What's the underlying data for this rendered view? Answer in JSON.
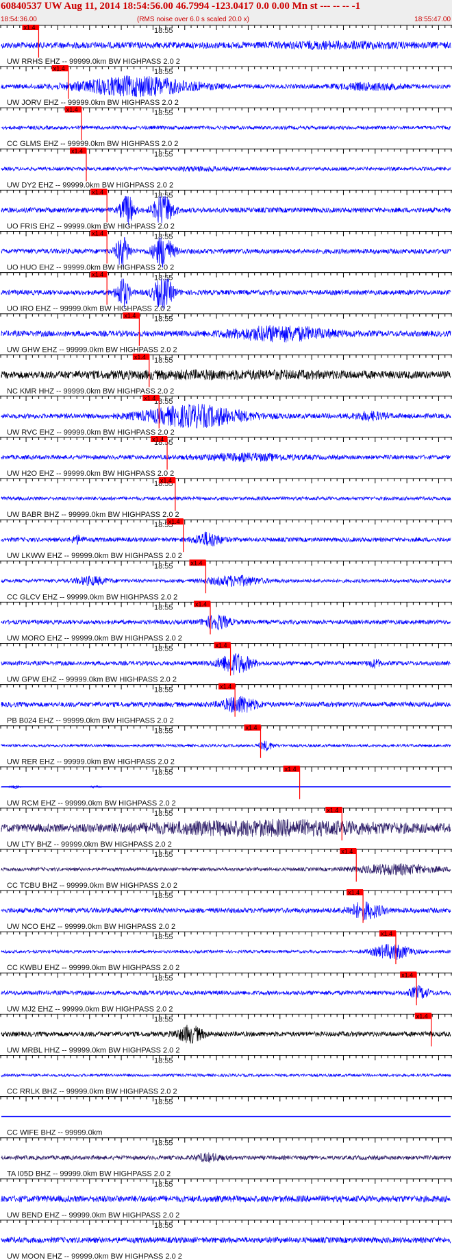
{
  "header": {
    "title": "60840537 UW Aug 11, 2014 18:54:56.00   46.7994 -123.0417  0.0 0.00 Mn st --- -- --   -1",
    "start_time": "18:54:36.00",
    "scale_note": "(RMS noise over 6.0 s scaled 20.0 x)",
    "end_time": "18:55:47.00",
    "minute_label": "18:55"
  },
  "pick_label": "x1.4",
  "colors": {
    "trace_blue": "#0000ff",
    "trace_black": "#000000",
    "trace_purple": "#2a1a66",
    "pick_red": "#ff0000",
    "header_red": "#cc0000",
    "axis": "#000000"
  },
  "traces": [
    {
      "label": "UW RRHS EHZ -- 99999.0km BW  HIGHPASS  2.0  2",
      "pick": 0.083,
      "amp": 0.18,
      "color": "blue",
      "env": [
        [
          0.75,
          0.2,
          0.5
        ]
      ]
    },
    {
      "label": "UW JORV EHZ -- 99999.0km BW  HIGHPASS  2.0  2",
      "pick": 0.149,
      "amp": 0.12,
      "color": "blue",
      "env": [
        [
          0.3,
          0.18,
          4.2
        ],
        [
          0.82,
          0.1,
          1.2
        ]
      ]
    },
    {
      "label": "CC GLMS EHZ -- 99999.0km BW  HIGHPASS  2.0  2",
      "pick": 0.178,
      "amp": 0.1,
      "color": "blue",
      "env": []
    },
    {
      "label": "UW DY2 EHZ -- 99999.0km BW  HIGHPASS  2.0  2",
      "pick": 0.189,
      "amp": 0.1,
      "color": "blue",
      "env": [
        [
          0.44,
          0.1,
          0.7
        ]
      ]
    },
    {
      "label": "UO FRIS EHZ -- 99999.0km BW  HIGHPASS  2.0  2",
      "pick": 0.235,
      "amp": 0.14,
      "color": "blue",
      "env": [
        [
          0.28,
          0.02,
          6
        ],
        [
          0.36,
          0.03,
          6
        ]
      ]
    },
    {
      "label": "UO HUO EHZ -- 99999.0km BW  HIGHPASS  2.0  2",
      "pick": 0.235,
      "amp": 0.14,
      "color": "blue",
      "env": [
        [
          0.27,
          0.02,
          6
        ],
        [
          0.36,
          0.03,
          6
        ]
      ]
    },
    {
      "label": "UO IRO EHZ -- 99999.0km BW  HIGHPASS  2.0  2",
      "pick": 0.235,
      "amp": 0.14,
      "color": "blue",
      "env": [
        [
          0.27,
          0.02,
          6
        ],
        [
          0.36,
          0.03,
          6
        ]
      ]
    },
    {
      "label": "UW GHW EHZ -- 99999.0km BW  HIGHPASS  2.0  2",
      "pick": 0.307,
      "amp": 0.16,
      "color": "blue",
      "env": [
        [
          0.62,
          0.15,
          2.2
        ]
      ]
    },
    {
      "label": "NC KMR HHZ -- 99999.0km BW  HIGHPASS  2.0  2",
      "pick": 0.329,
      "amp": 0.2,
      "color": "black",
      "env": [
        [
          0.5,
          0.45,
          0.5
        ]
      ]
    },
    {
      "label": "UW RVC EHZ -- 99999.0km BW  HIGHPASS  2.0  2",
      "pick": 0.351,
      "amp": 0.14,
      "color": "blue",
      "env": [
        [
          0.43,
          0.15,
          4
        ],
        [
          0.82,
          0.05,
          1.2
        ]
      ]
    },
    {
      "label": "UW H2O EHZ -- 99999.0km BW  HIGHPASS  2.0  2",
      "pick": 0.369,
      "amp": 0.12,
      "color": "blue",
      "env": [
        [
          0.55,
          0.15,
          1.2
        ]
      ]
    },
    {
      "label": "UW BABR BHZ -- 99999.0km BW  HIGHPASS  2.0  2",
      "pick": 0.387,
      "amp": 0.1,
      "color": "blue",
      "env": []
    },
    {
      "label": "UW LKWW EHZ -- 99999.0km BW  HIGHPASS  2.0  2",
      "pick": 0.405,
      "amp": 0.12,
      "color": "blue",
      "env": [
        [
          0.46,
          0.04,
          3
        ],
        [
          0.17,
          0.02,
          1.5
        ]
      ]
    },
    {
      "label": "CC GLCV EHZ -- 99999.0km BW  HIGHPASS  2.0  2",
      "pick": 0.455,
      "amp": 0.1,
      "color": "blue",
      "env": [
        [
          0.2,
          0.05,
          2
        ],
        [
          0.52,
          0.08,
          2.5
        ]
      ]
    },
    {
      "label": "UW MORO EHZ -- 99999.0km BW  HIGHPASS  2.0  2",
      "pick": 0.465,
      "amp": 0.12,
      "color": "blue",
      "env": [
        [
          0.48,
          0.04,
          3
        ]
      ]
    },
    {
      "label": "UW GPW EHZ -- 99999.0km BW  HIGHPASS  2.0  2",
      "pick": 0.51,
      "amp": 0.12,
      "color": "blue",
      "env": [
        [
          0.52,
          0.05,
          4.5
        ],
        [
          0.83,
          0.02,
          1.5
        ]
      ]
    },
    {
      "label": "PB B024 EHZ -- 99999.0km BW  HIGHPASS  2.0  2",
      "pick": 0.52,
      "amp": 0.14,
      "color": "blue",
      "env": [
        [
          0.53,
          0.05,
          3
        ]
      ]
    },
    {
      "label": "UW RER EHZ -- 99999.0km BW  HIGHPASS  2.0  2",
      "pick": 0.577,
      "amp": 0.08,
      "color": "blue",
      "env": [
        [
          0.59,
          0.02,
          3
        ]
      ]
    },
    {
      "label": "UW RCM EHZ -- 99999.0km BW  HIGHPASS  2.0  2",
      "pick": 0.664,
      "amp": 0.01,
      "color": "blue",
      "env": [
        [
          0.03,
          0.015,
          10
        ],
        [
          0.21,
          0.015,
          8
        ]
      ]
    },
    {
      "label": "UW LTY BHZ -- 99999.0km BW  HIGHPASS  2.0  2",
      "pick": 0.758,
      "amp": 0.22,
      "color": "purple",
      "env": [
        [
          0.6,
          0.4,
          1.3
        ]
      ]
    },
    {
      "label": "CC TCBU BHZ -- 99999.0km BW  HIGHPASS  2.0  2",
      "pick": 0.79,
      "amp": 0.1,
      "color": "purple",
      "env": [
        [
          0.88,
          0.12,
          2.5
        ]
      ]
    },
    {
      "label": "UW NCO EHZ -- 99999.0km BW  HIGHPASS  2.0  2",
      "pick": 0.805,
      "amp": 0.14,
      "color": "blue",
      "env": [
        [
          0.81,
          0.05,
          3
        ]
      ]
    },
    {
      "label": "CC KWBU EHZ -- 99999.0km BW  HIGHPASS  2.0  2",
      "pick": 0.878,
      "amp": 0.08,
      "color": "blue",
      "env": [
        [
          0.87,
          0.06,
          5
        ]
      ]
    },
    {
      "label": "UW MJ2 EHZ -- 99999.0km BW  HIGHPASS  2.0  2",
      "pick": 0.924,
      "amp": 0.12,
      "color": "blue",
      "env": [
        [
          0.93,
          0.03,
          2.5
        ]
      ]
    },
    {
      "label": "UW MRBL HHZ -- 99999.0km BW  HIGHPASS  2.0  2",
      "pick": 0.957,
      "amp": 0.14,
      "color": "black",
      "env": [
        [
          0.42,
          0.04,
          3
        ]
      ]
    },
    {
      "label": "CC RRLK BHZ -- 99999.0km BW  HIGHPASS  2.0  2",
      "pick": null,
      "amp": 0.08,
      "color": "blue",
      "env": []
    },
    {
      "label": "CC WIFE BHZ -- 99999.0km",
      "pick": null,
      "amp": 0,
      "color": "blue",
      "env": []
    },
    {
      "label": "TA I05D BHZ -- 99999.0km BW  HIGHPASS  2.0  2",
      "pick": null,
      "amp": 0.12,
      "color": "purple",
      "env": [
        [
          0.46,
          0.04,
          1.5
        ]
      ]
    },
    {
      "label": "UW BEND EHZ -- 99999.0km BW  HIGHPASS  2.0  2",
      "pick": null,
      "amp": 0.18,
      "color": "blue",
      "env": []
    },
    {
      "label": "UW MOON EHZ -- 99999.0km BW  HIGHPASS  2.0  2",
      "pick": null,
      "amp": 0.16,
      "color": "blue",
      "env": []
    }
  ]
}
